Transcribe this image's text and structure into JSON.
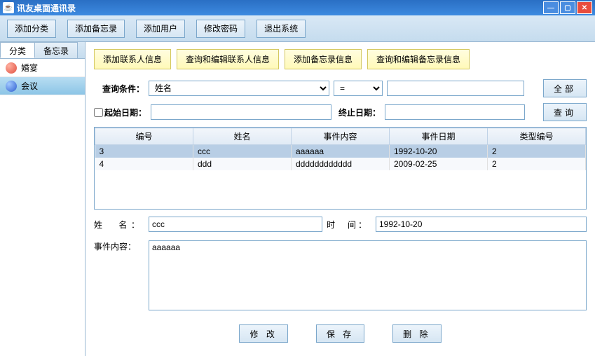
{
  "window": {
    "title": "讯友桌面通讯录"
  },
  "toolbar": {
    "add_category": "添加分类",
    "add_memo": "添加备忘录",
    "add_user": "添加用户",
    "change_pwd": "修改密码",
    "exit": "退出系统"
  },
  "sidebar": {
    "tabs": {
      "cat": "分类",
      "memo": "备忘录"
    },
    "items": [
      {
        "label": "婚宴"
      },
      {
        "label": "会议"
      }
    ]
  },
  "main_tabs": {
    "add_contact": "添加联系人信息",
    "edit_contact": "查询和编辑联系人信息",
    "add_memo": "添加备忘录信息",
    "edit_memo": "查询和编辑备忘录信息"
  },
  "query": {
    "label": "查询条件：",
    "field_selected": "姓名",
    "op_selected": "=",
    "value": "",
    "btn_all": "全部",
    "start_date_label": "起始日期：",
    "start_date": "",
    "end_date_label": "终止日期：",
    "end_date": "",
    "btn_query": "查询"
  },
  "table": {
    "headers": {
      "id": "编号",
      "name": "姓名",
      "content": "事件内容",
      "date": "事件日期",
      "type": "类型编号"
    },
    "rows": [
      {
        "id": "3",
        "name": "ccc",
        "content": "aaaaaa",
        "date": "1992-10-20",
        "type": "2"
      },
      {
        "id": "4",
        "name": "ddd",
        "content": "dddddddddddd",
        "date": "2009-02-25",
        "type": "2"
      }
    ]
  },
  "form": {
    "name_label": "姓　名：",
    "name": "ccc",
    "time_label": "时　间：",
    "time": "1992-10-20",
    "content_label": "事件内容：",
    "content": "aaaaaa"
  },
  "actions": {
    "modify": "修 改",
    "save": "保 存",
    "delete": "删 除"
  }
}
